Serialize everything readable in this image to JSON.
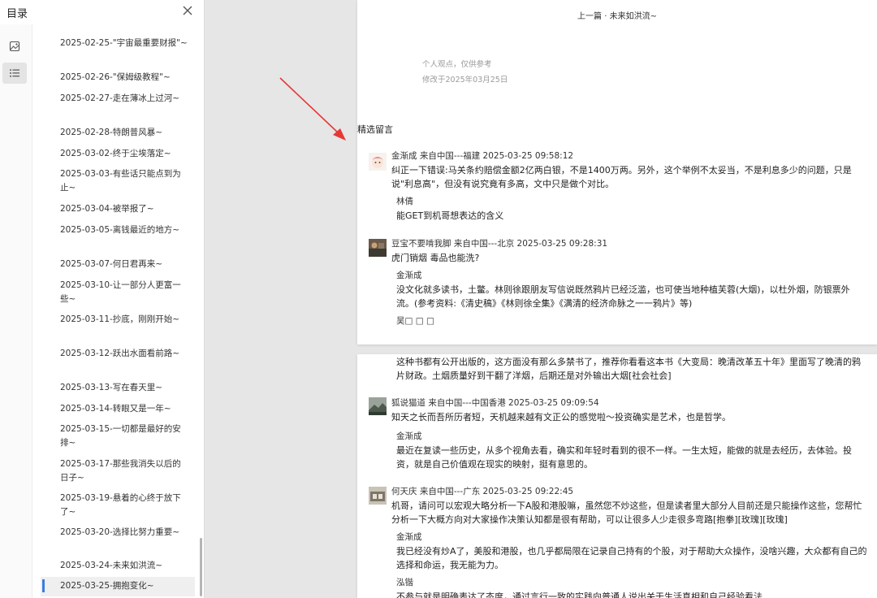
{
  "sidebar": {
    "title": "目录",
    "icons": {
      "close": "close-icon",
      "image": "image-icon",
      "list": "list-icon"
    },
    "items": [
      "2025-02-25-\"宇宙最重要财报\"~",
      "2025-02-26-\"保姆级教程\"~",
      "2025-02-27-走在薄冰上过河~",
      "2025-02-28-特朗普风暴~",
      "2025-03-02-终于尘埃落定~",
      "2025-03-03-有些话只能点到为止~",
      "2025-03-04-被举报了~",
      "2025-03-05-离钱最近的地方~",
      "2025-03-07-何日君再来~",
      "2025-03-10-让一部分人更富一些~",
      "2025-03-11-抄底，刚刚开始~",
      "2025-03-12-跃出水面看前路~",
      "2025-03-13-写在春天里~",
      "2025-03-14-转眼又是一年~",
      "2025-03-15-一切都是最好的安排~",
      "2025-03-17-那些我消失以后的日子~",
      "2025-03-19-悬着的心终于放下了~",
      "2025-03-20-选择比努力重要~",
      "2025-03-24-未来如洪流~",
      "2025-03-25-拥抱变化~"
    ]
  },
  "article": {
    "prev_link": "上一篇 · 未来如洪流~",
    "opinion_note": "个人观点，仅供参考",
    "modified": "修改于2025年03月25日",
    "featured_label": "精选留言"
  },
  "comments": [
    {
      "header": "金渐成 来自中国---福建 2025-03-25 09:58:12",
      "body": "纠正一下错误:马关条约赔偿金额2亿两白银，不是1400万两。另外，这个举例不太妥当，不是利息多少的问题，只是说\"利息高\"，但没有说究竟有多高，文中只是做个对比。",
      "replies": [
        {
          "name": "林倩",
          "body": "能GET到机哥想表达的含义"
        }
      ]
    },
    {
      "header": "豆宝不要啃我脚 来自中国---北京 2025-03-25 09:28:31",
      "body": "虎门销烟 毒品也能洗?",
      "replies": [
        {
          "name": "金渐成",
          "body": "没文化就多读书，土鳖。林则徐跟朋友写信说既然鸦片已经泛滥，也可使当地种植芙蓉(大烟)，以杜外烟，防银票外流。(参考资料:《清史稿》《林则徐全集》《满清的经济命脉之一一鸦片》等)"
        },
        {
          "name": "吴□ □ □",
          "body": "这种书都有公开出版的，这方面没有那么多禁书了，推荐你看看这本书《大变局：晚清改革五十年》里面写了晚清的鸦片财政。土烟质量好到干翻了洋烟，后期还是对外输出大烟[社会社会]"
        }
      ]
    },
    {
      "header": "狐说猫道 来自中国---中国香港 2025-03-25 09:09:54",
      "body": "知天之长而吾所历者短，天机越来越有文正公的感觉啦～投资确实是艺术，也是哲学。",
      "replies": [
        {
          "name": "金渐成",
          "body": "最近在复读一些历史，从多个视角去看，确实和年轻时看到的很不一样。一生太短，能做的就是去经历，去体验。投资，就是自己价值观在现实的映射，挺有意思的。"
        }
      ]
    },
    {
      "header": "何天庆 来自中国---广东 2025-03-25 09:22:45",
      "body": "机哥，请问可以宏观大略分析一下A股和港股嘛，虽然您不炒这些，但是读者里大部分人目前还是只能操作这些，您帮忙分析一下大概方向对大家操作决策认知都是很有帮助，可以让很多人少走很多弯路[抱拳][玫瑰][玫瑰]",
      "replies": [
        {
          "name": "金渐成",
          "body": "我已经没有炒A了，美股和港股，也几乎都局限在记录自己持有的个股，对于帮助大众操作，没啥兴趣，大众都有自己的选择和命运，我无能为力。"
        },
        {
          "name": "泓锴",
          "body": "不参与就是明确表达了态度，通过言行一致的实践向普通人说出关于生活真相和自己经验看法"
        }
      ]
    }
  ],
  "colors": {
    "annotation_arrow": "#e53935",
    "active_marker": "#3a7be0"
  }
}
